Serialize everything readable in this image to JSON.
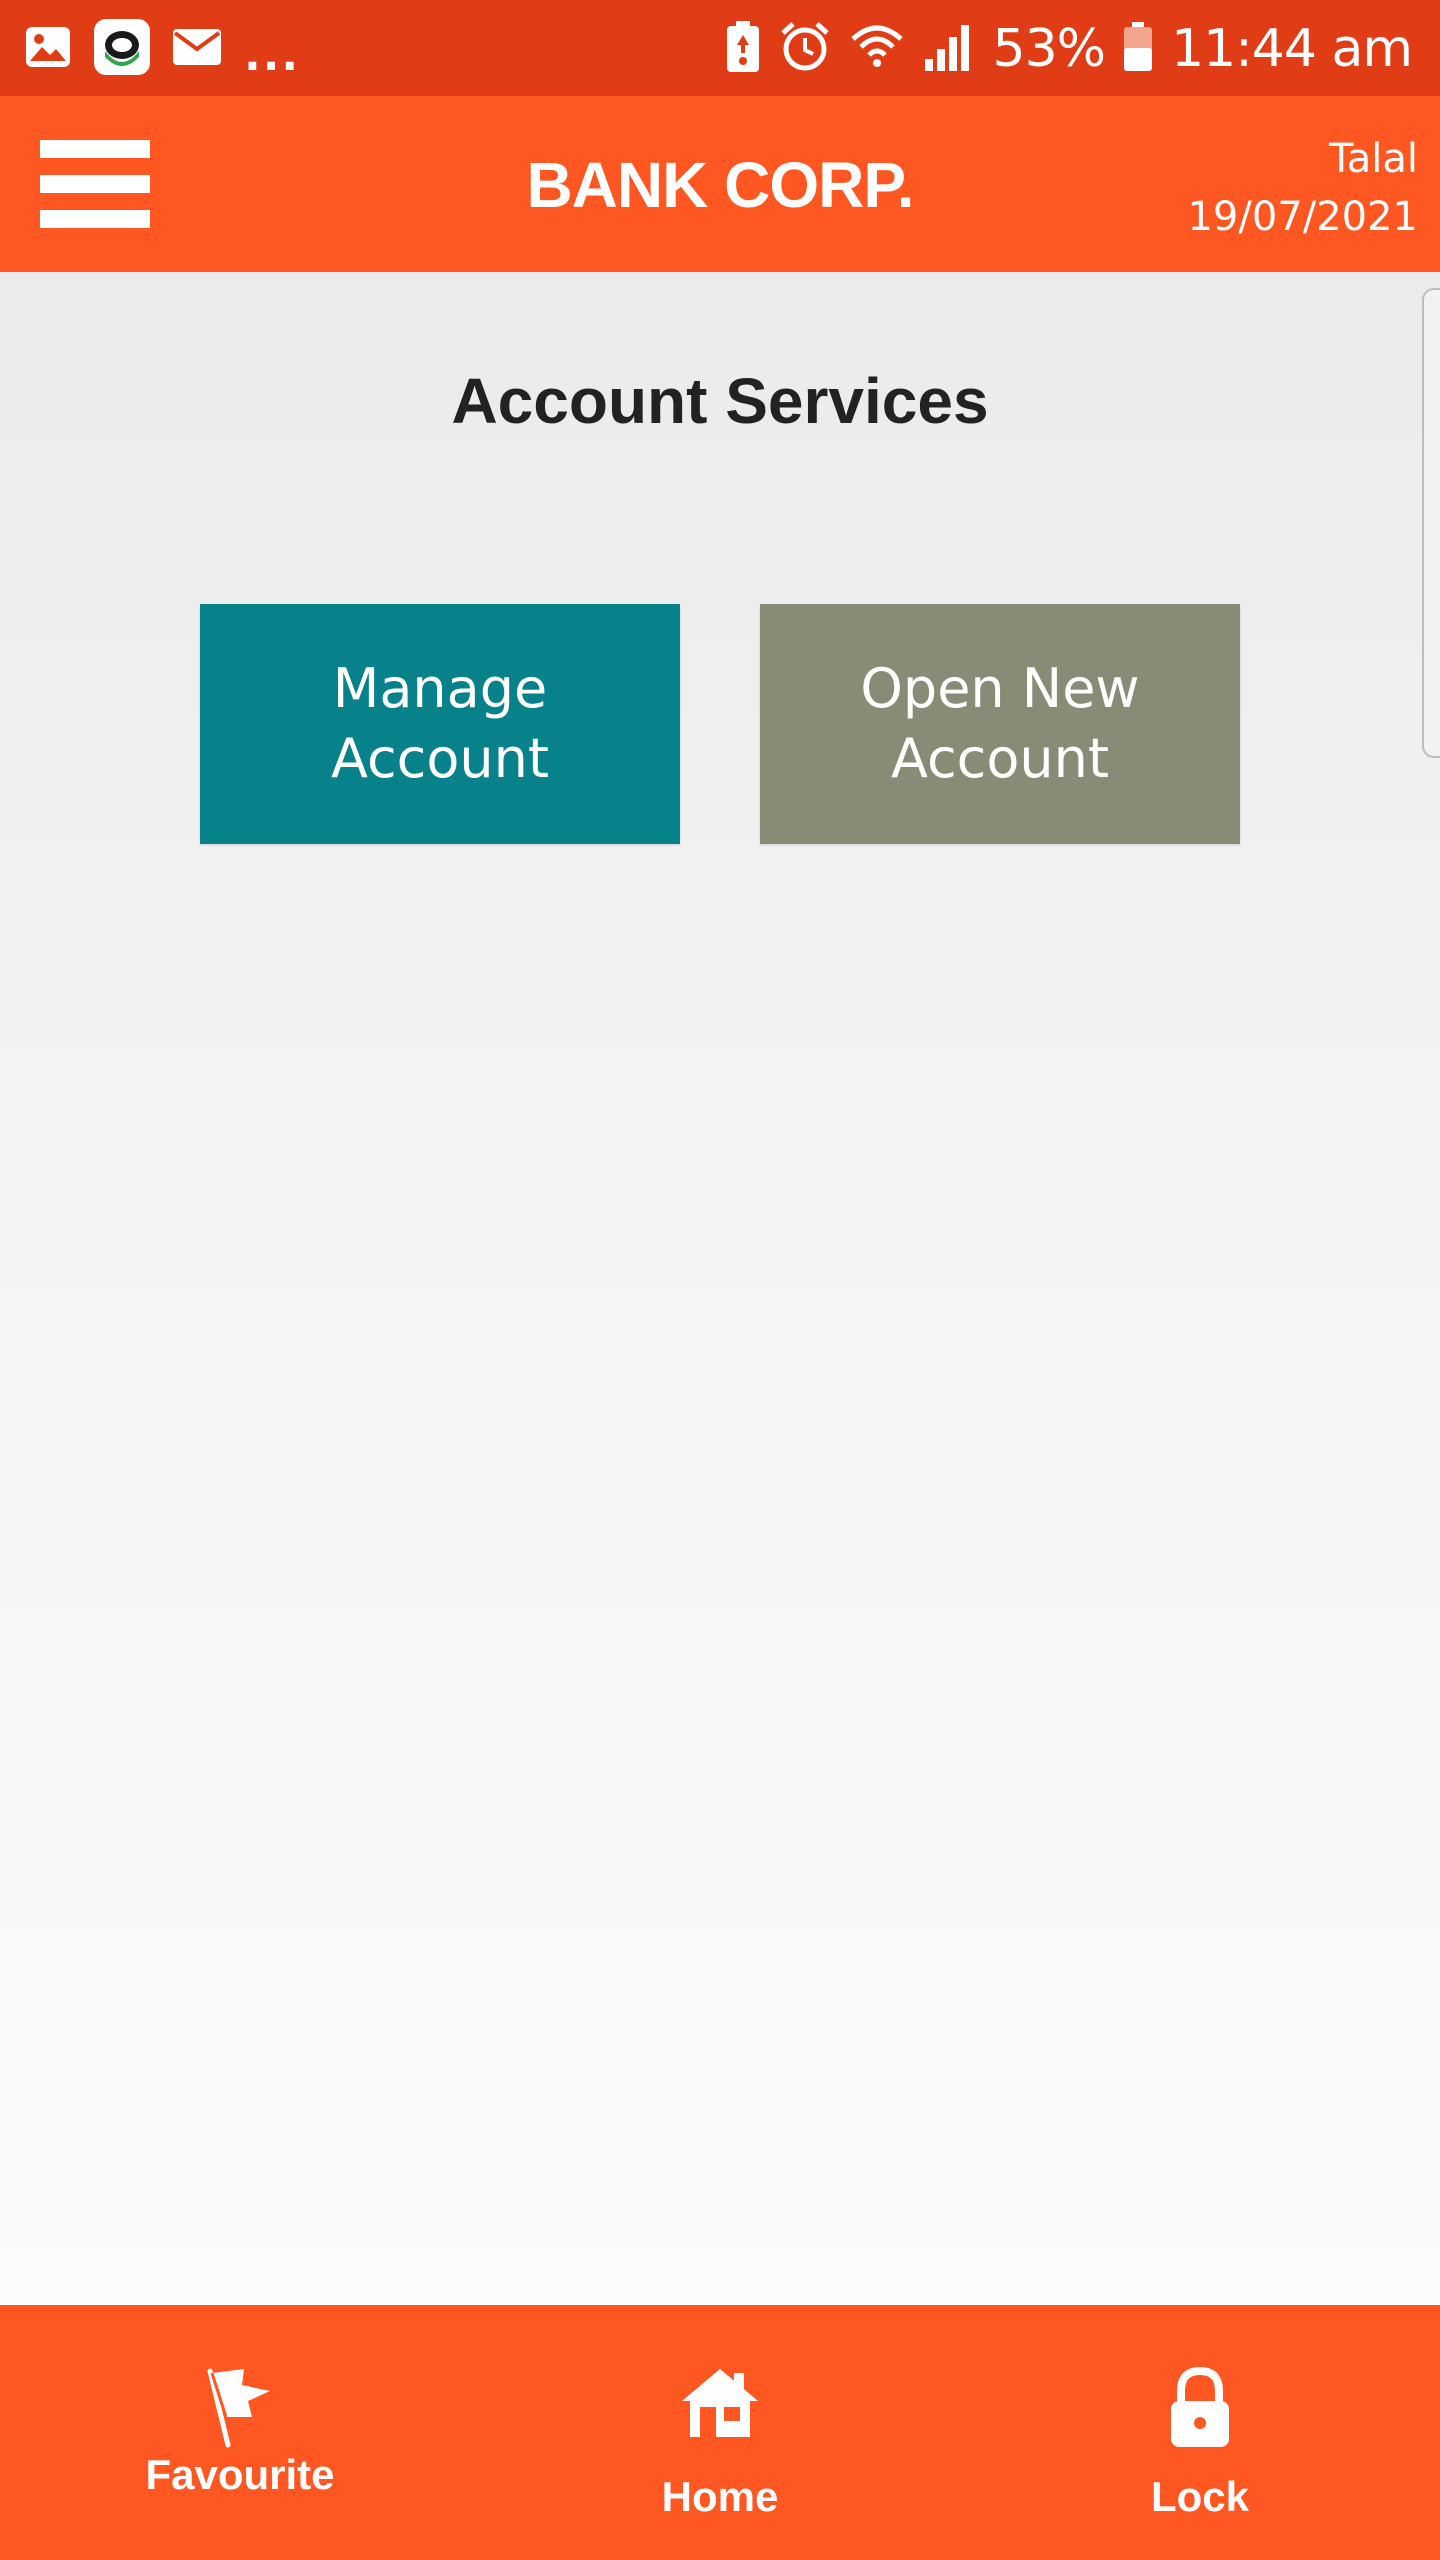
{
  "status_bar": {
    "overflow_dots": "...",
    "battery_percent": "53%",
    "time": "11:44 am",
    "icons_left": [
      "gallery-icon",
      "app-notification-icon",
      "email-icon"
    ],
    "icons_right": [
      "battery-saver-icon",
      "alarm-icon",
      "wifi-icon",
      "signal-icon",
      "battery-icon"
    ]
  },
  "header": {
    "menu_icon": "hamburger-menu-icon",
    "brand": "BANK CORP.",
    "user_name": "Talal",
    "date": "19/07/2021"
  },
  "main": {
    "title": "Account Services",
    "tiles": [
      {
        "label": "Manage\nAccount",
        "color": "#07828a"
      },
      {
        "label": "Open New\nAccount",
        "color": "#898b76"
      }
    ]
  },
  "bottom_nav": {
    "items": [
      {
        "label": "Favourite",
        "icon": "flag-icon"
      },
      {
        "label": "Home",
        "icon": "home-icon"
      },
      {
        "label": "Lock",
        "icon": "lock-icon"
      }
    ]
  },
  "colors": {
    "status_bar": "#e03c15",
    "header": "#ff5722",
    "bottom_nav": "#ff5722",
    "text_dark": "#222222"
  }
}
